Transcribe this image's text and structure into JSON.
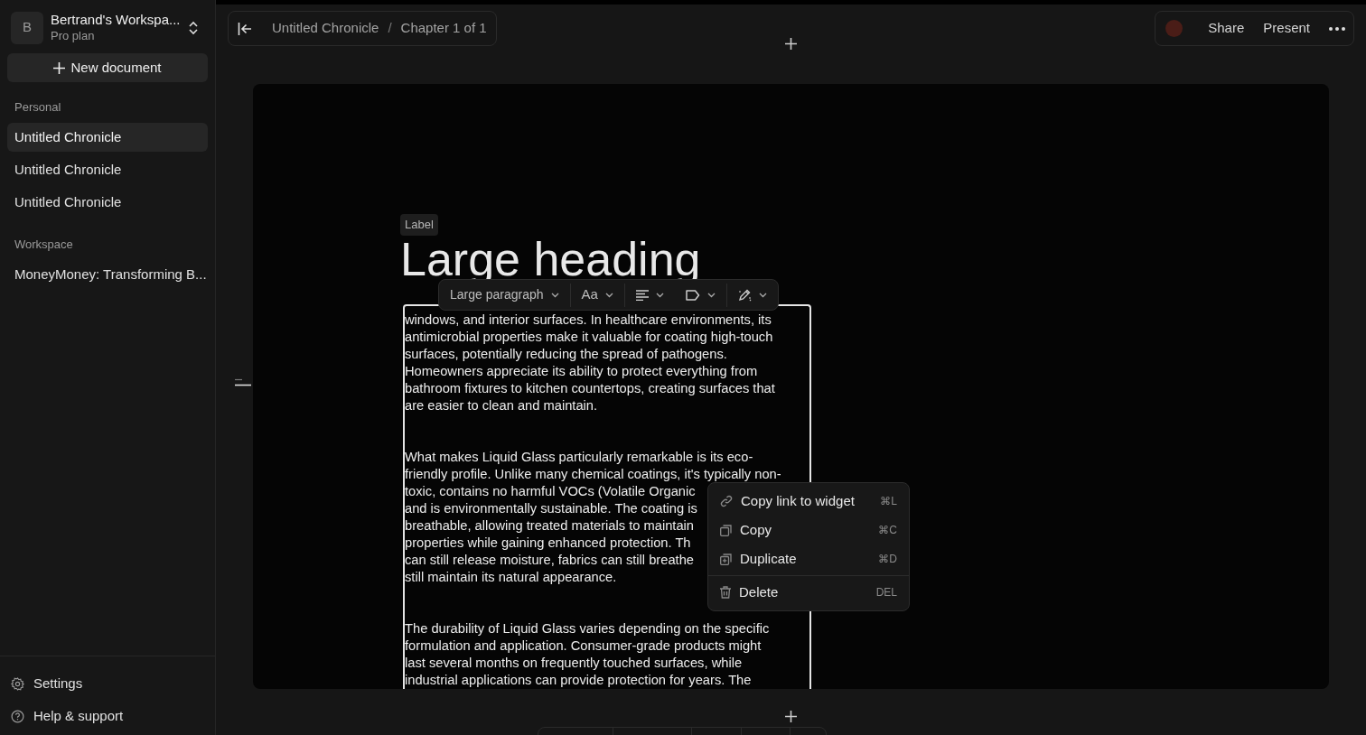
{
  "sidebar": {
    "workspace": {
      "avatar": "B",
      "name": "Bertrand's Workspa...",
      "plan": "Pro plan"
    },
    "new_button": "New document",
    "sections": [
      {
        "title": "Personal",
        "items": [
          {
            "label": "Untitled Chronicle",
            "selected": true
          },
          {
            "label": "Untitled Chronicle",
            "selected": false
          },
          {
            "label": "Untitled Chronicle",
            "selected": false
          }
        ]
      },
      {
        "title": "Workspace",
        "items": [
          {
            "label": "MoneyMoney: Transforming B...",
            "selected": false
          }
        ]
      }
    ],
    "footer": [
      {
        "kind": "settings",
        "label": "Settings"
      },
      {
        "kind": "help",
        "label": "Help & support"
      }
    ]
  },
  "breadcrumb": [
    "Untitled Chronicle",
    "Chapter 1 of 1"
  ],
  "breadcrumb_separator": "/",
  "top_actions": {
    "share": "Share",
    "present": "Present"
  },
  "document": {
    "label": "Label",
    "heading": "Large heading",
    "paragraphs": [
      [
        "windows, and interior surfaces. In healthcare environments, its",
        "antimicrobial properties make it valuable for coating high-touch",
        "surfaces, potentially reducing the spread of pathogens.",
        "Homeowners appreciate its ability to protect everything from",
        "bathroom fixtures to kitchen countertops, creating surfaces that",
        "are easier to clean and maintain."
      ],
      [
        "What makes Liquid Glass particularly remarkable is its eco-",
        "friendly profile. Unlike many chemical coatings, it's typically non-",
        "toxic, contains no harmful VOCs (Volatile Organic",
        "and is environmentally sustainable. The coating is",
        "breathable, allowing treated materials to maintain",
        "properties while gaining enhanced protection. Th",
        "can still release moisture, fabrics can still breathe",
        "still maintain its natural appearance."
      ],
      [
        "The durability of Liquid Glass varies depending on the specific",
        "formulation and application. Consumer-grade products might",
        "last several months on frequently touched surfaces, while",
        "industrial applications can provide protection for years. The"
      ]
    ]
  },
  "format_toolbar": [
    {
      "kind": "style",
      "label": "Large paragraph"
    },
    {
      "kind": "font",
      "label": "Aa"
    },
    {
      "kind": "align"
    },
    {
      "kind": "tag"
    },
    {
      "kind": "pen"
    }
  ],
  "context_menu": [
    {
      "kind": "link",
      "label": "Copy link to widget",
      "shortcut": "⌘L"
    },
    {
      "kind": "copy",
      "label": "Copy",
      "shortcut": "⌘C"
    },
    {
      "kind": "duplicate",
      "label": "Duplicate",
      "shortcut": "⌘D"
    },
    {
      "kind": "delete",
      "label": "Delete",
      "shortcut": "DEL"
    }
  ]
}
